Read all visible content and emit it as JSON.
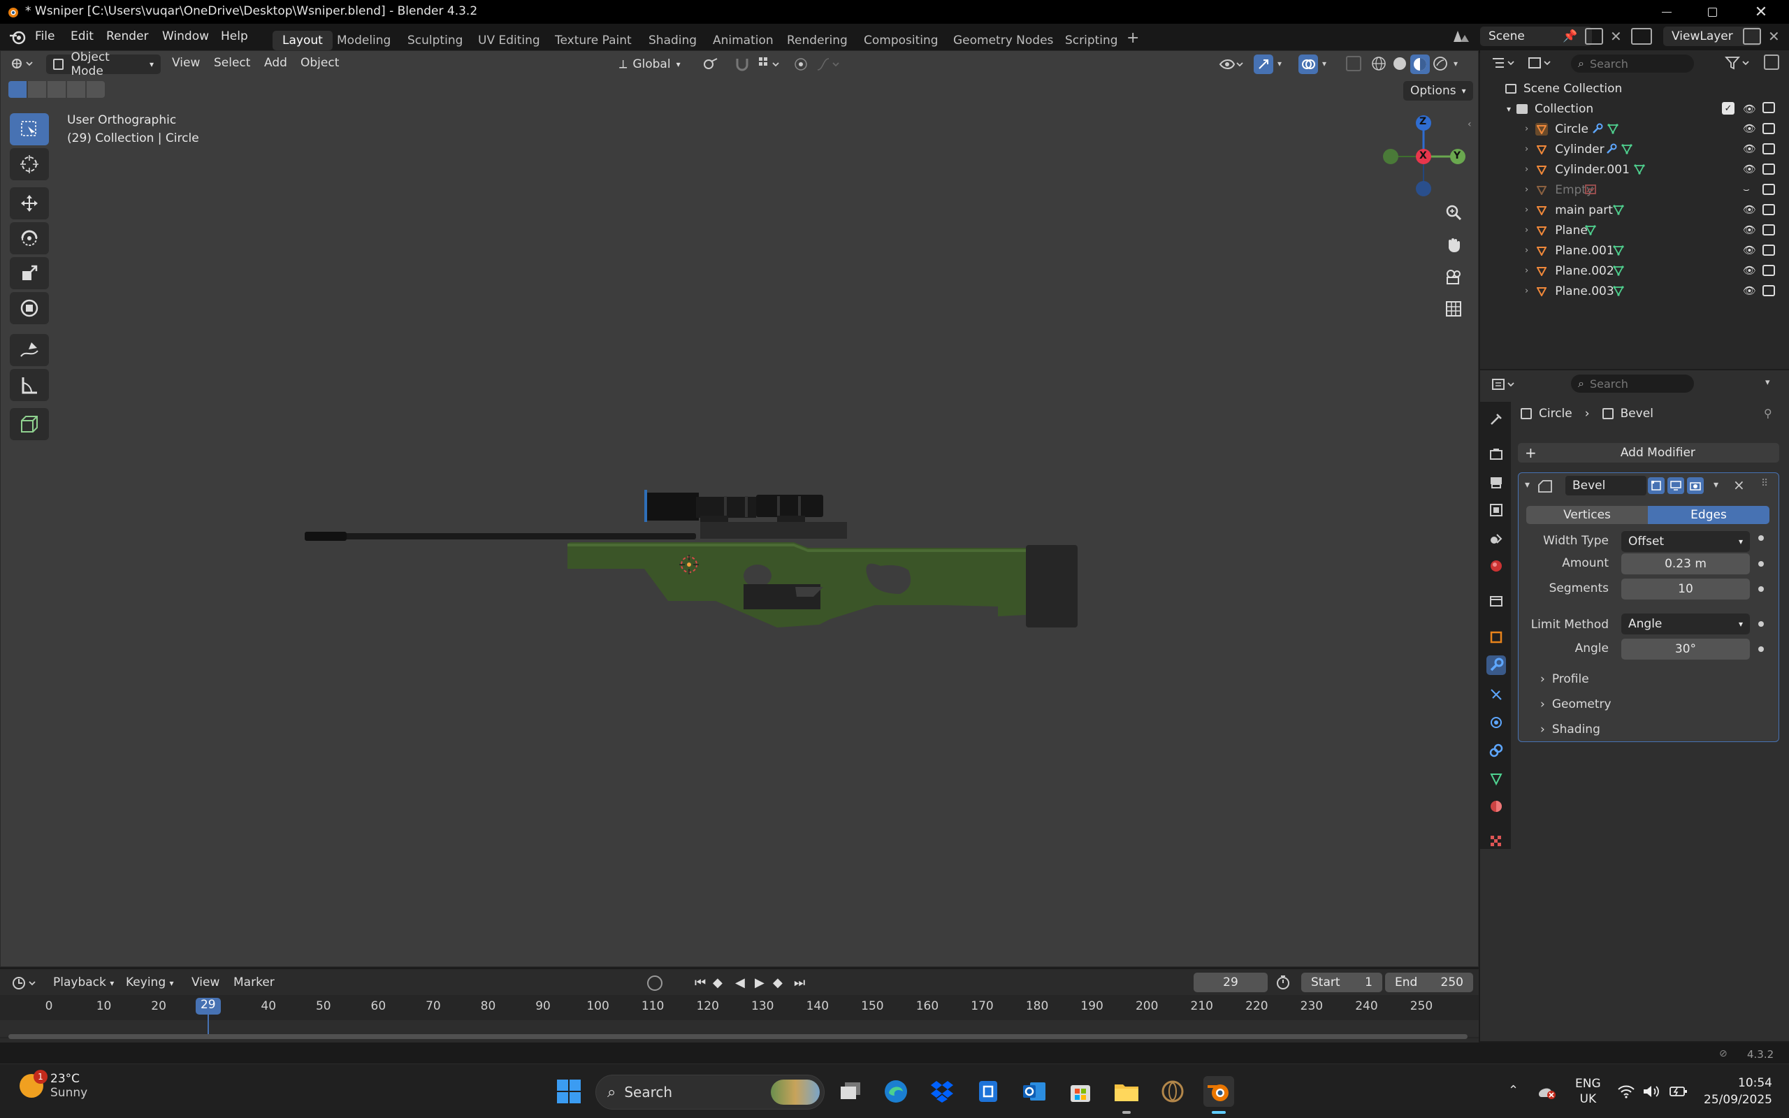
{
  "window": {
    "title": "* Wsniper [C:\\Users\\vuqar\\OneDrive\\Desktop\\Wsniper.blend] - Blender 4.3.2"
  },
  "menu": {
    "file": "File",
    "edit": "Edit",
    "render": "Render",
    "window": "Window",
    "help": "Help"
  },
  "workspaces": [
    {
      "label": "Layout"
    },
    {
      "label": "Modeling"
    },
    {
      "label": "Sculpting"
    },
    {
      "label": "UV Editing"
    },
    {
      "label": "Texture Paint"
    },
    {
      "label": "Shading"
    },
    {
      "label": "Animation"
    },
    {
      "label": "Rendering"
    },
    {
      "label": "Compositing"
    },
    {
      "label": "Geometry Nodes"
    },
    {
      "label": "Scripting"
    }
  ],
  "scene": {
    "name": "Scene",
    "view_layer": "ViewLayer"
  },
  "viewport": {
    "mode": "Object Mode",
    "menu_view": "View",
    "menu_select": "Select",
    "menu_add": "Add",
    "menu_object": "Object",
    "orientation": "Global",
    "options": "Options",
    "info_line1": "User Orthographic",
    "info_line2": "(29) Collection | Circle",
    "axes": {
      "z": "Z",
      "x": "X",
      "y": "Y"
    }
  },
  "outliner": {
    "search_placeholder": "Search",
    "scene_collection": "Scene Collection",
    "collection": "Collection",
    "items": [
      {
        "name": "Circle"
      },
      {
        "name": "Cylinder"
      },
      {
        "name": "Cylinder.001"
      },
      {
        "name": "Empty"
      },
      {
        "name": "main part"
      },
      {
        "name": "Plane"
      },
      {
        "name": "Plane.001"
      },
      {
        "name": "Plane.002"
      },
      {
        "name": "Plane.003"
      }
    ]
  },
  "properties": {
    "search_placeholder": "Search",
    "breadcrumb_object": "Circle",
    "breadcrumb_modifier": "Bevel",
    "add_modifier": "Add Modifier",
    "modifier_name": "Bevel",
    "tab_vertices": "Vertices",
    "tab_edges": "Edges",
    "width_type_label": "Width Type",
    "width_type_value": "Offset",
    "amount_label": "Amount",
    "amount_value": "0.23 m",
    "segments_label": "Segments",
    "segments_value": "10",
    "limit_method_label": "Limit Method",
    "limit_method_value": "Angle",
    "angle_label": "Angle",
    "angle_value": "30°",
    "profile": "Profile",
    "geometry": "Geometry",
    "shading": "Shading"
  },
  "timeline": {
    "playback": "Playback",
    "keying": "Keying",
    "view": "View",
    "marker": "Marker",
    "current_frame": "29",
    "start_label": "Start",
    "start_value": "1",
    "end_label": "End",
    "end_value": "250",
    "ticks": [
      "0",
      "10",
      "20",
      "29",
      "40",
      "50",
      "60",
      "70",
      "80",
      "90",
      "100",
      "110",
      "120",
      "130",
      "140",
      "150",
      "160",
      "170",
      "180",
      "190",
      "200",
      "210",
      "220",
      "230",
      "240",
      "250"
    ]
  },
  "status": {
    "version": "4.3.2"
  },
  "taskbar": {
    "weather_temp": "23°C",
    "weather_desc": "Sunny",
    "weather_badge": "1",
    "search": "Search",
    "lang1": "ENG",
    "lang2": "UK",
    "time": "10:54",
    "date": "25/09/2025"
  }
}
